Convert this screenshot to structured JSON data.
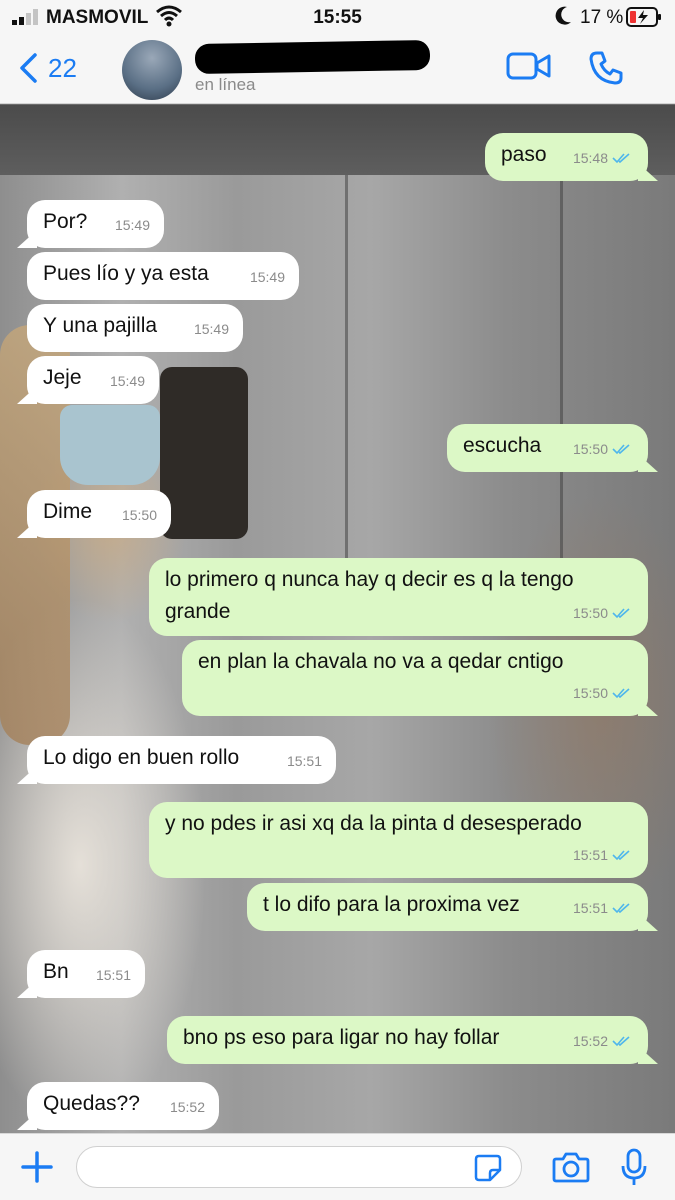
{
  "status_bar": {
    "carrier": "MASMOVIL",
    "time": "15:55",
    "battery_percent": "17 %"
  },
  "header": {
    "back_count": "22",
    "presence": "en línea",
    "icons": [
      "chevron-left-icon",
      "video-call-icon",
      "phone-call-icon"
    ]
  },
  "messages": [
    {
      "dir": "out",
      "text": "paso",
      "time": "15:48"
    },
    {
      "dir": "in",
      "text": "Por?",
      "time": "15:49"
    },
    {
      "dir": "in",
      "text": "Pues lío y ya esta",
      "time": "15:49"
    },
    {
      "dir": "in",
      "text": "Y una pajilla",
      "time": "15:49"
    },
    {
      "dir": "in",
      "text": "Jeje",
      "time": "15:49"
    },
    {
      "dir": "out",
      "text": "escucha",
      "time": "15:50"
    },
    {
      "dir": "in",
      "text": "Dime",
      "time": "15:50"
    },
    {
      "dir": "out",
      "text": "lo primero q nunca hay q decir es q la tengo grande",
      "time": "15:50"
    },
    {
      "dir": "out",
      "text": "en plan la chavala no va a qedar cntigo",
      "time": "15:50"
    },
    {
      "dir": "in",
      "text": "Lo digo en buen rollo",
      "time": "15:51"
    },
    {
      "dir": "out",
      "text": "y no pdes ir asi xq da la pinta d desesperado",
      "time": "15:51"
    },
    {
      "dir": "out",
      "text": "t lo difo para la proxima vez",
      "time": "15:51"
    },
    {
      "dir": "in",
      "text": "Bn",
      "time": "15:51"
    },
    {
      "dir": "out",
      "text": "bno ps eso para ligar no hay follar",
      "time": "15:52"
    },
    {
      "dir": "in",
      "text": "Quedas??",
      "time": "15:52"
    }
  ],
  "input_bar": {
    "placeholder": "",
    "icons": [
      "plus-icon",
      "sticker-icon",
      "camera-icon",
      "microphone-icon"
    ]
  },
  "colors": {
    "accent": "#1b7cf3",
    "outgoing_bubble": "#dcf8c6",
    "incoming_bubble": "#ffffff",
    "read_ticks": "#4fb6ec"
  }
}
